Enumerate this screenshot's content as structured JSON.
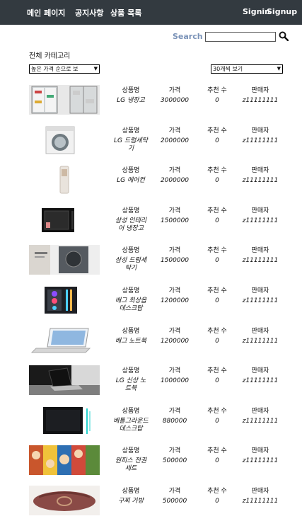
{
  "nav": {
    "home": "메인 페이지",
    "notice": "공지사항",
    "products": "상품 목록",
    "signin": "Signin",
    "signup": "Signup"
  },
  "search": {
    "label": "Search",
    "value": ""
  },
  "category_title": "전체 카테고리",
  "sort_select": "높은 가격 순으로 보",
  "count_select": "30개씩 보기",
  "columns": {
    "name": "상품명",
    "price": "가격",
    "recommend": "추천 수",
    "seller": "판매자"
  },
  "products": [
    {
      "name": "LG 냉장고",
      "price": "3000000",
      "recommend": "0",
      "seller": "z11111111",
      "image": "refrigerator"
    },
    {
      "name": "LG 드럼세탁기",
      "price": "2000000",
      "recommend": "0",
      "seller": "z11111111",
      "image": "washer"
    },
    {
      "name": "LG 에어컨",
      "price": "2000000",
      "recommend": "0",
      "seller": "z11111111",
      "image": "air-conditioner"
    },
    {
      "name": "삼성 인테리어 냉장고",
      "price": "1500000",
      "recommend": "0",
      "seller": "z11111111",
      "image": "mini-fridge"
    },
    {
      "name": "삼성 드럼세탁기",
      "price": "1500000",
      "recommend": "0",
      "seller": "z11111111",
      "image": "drum-washer"
    },
    {
      "name": "배그 최상옵 데스크탑",
      "price": "1200000",
      "recommend": "0",
      "seller": "z11111111",
      "image": "gaming-pc"
    },
    {
      "name": "배그 노트북",
      "price": "1200000",
      "recommend": "0",
      "seller": "z11111111",
      "image": "laptop"
    },
    {
      "name": "LG 신상 노트북",
      "price": "1000000",
      "recommend": "0",
      "seller": "z11111111",
      "image": "laptop-desk"
    },
    {
      "name": "배틀그라운드 데스크탑",
      "price": "880000",
      "recommend": "0",
      "seller": "z11111111",
      "image": "desktop"
    },
    {
      "name": "원피스 전권세트",
      "price": "500000",
      "recommend": "0",
      "seller": "z11111111",
      "image": "comics"
    },
    {
      "name": "구찌 가방",
      "price": "500000",
      "recommend": "0",
      "seller": "z11111111",
      "image": "bag"
    }
  ]
}
